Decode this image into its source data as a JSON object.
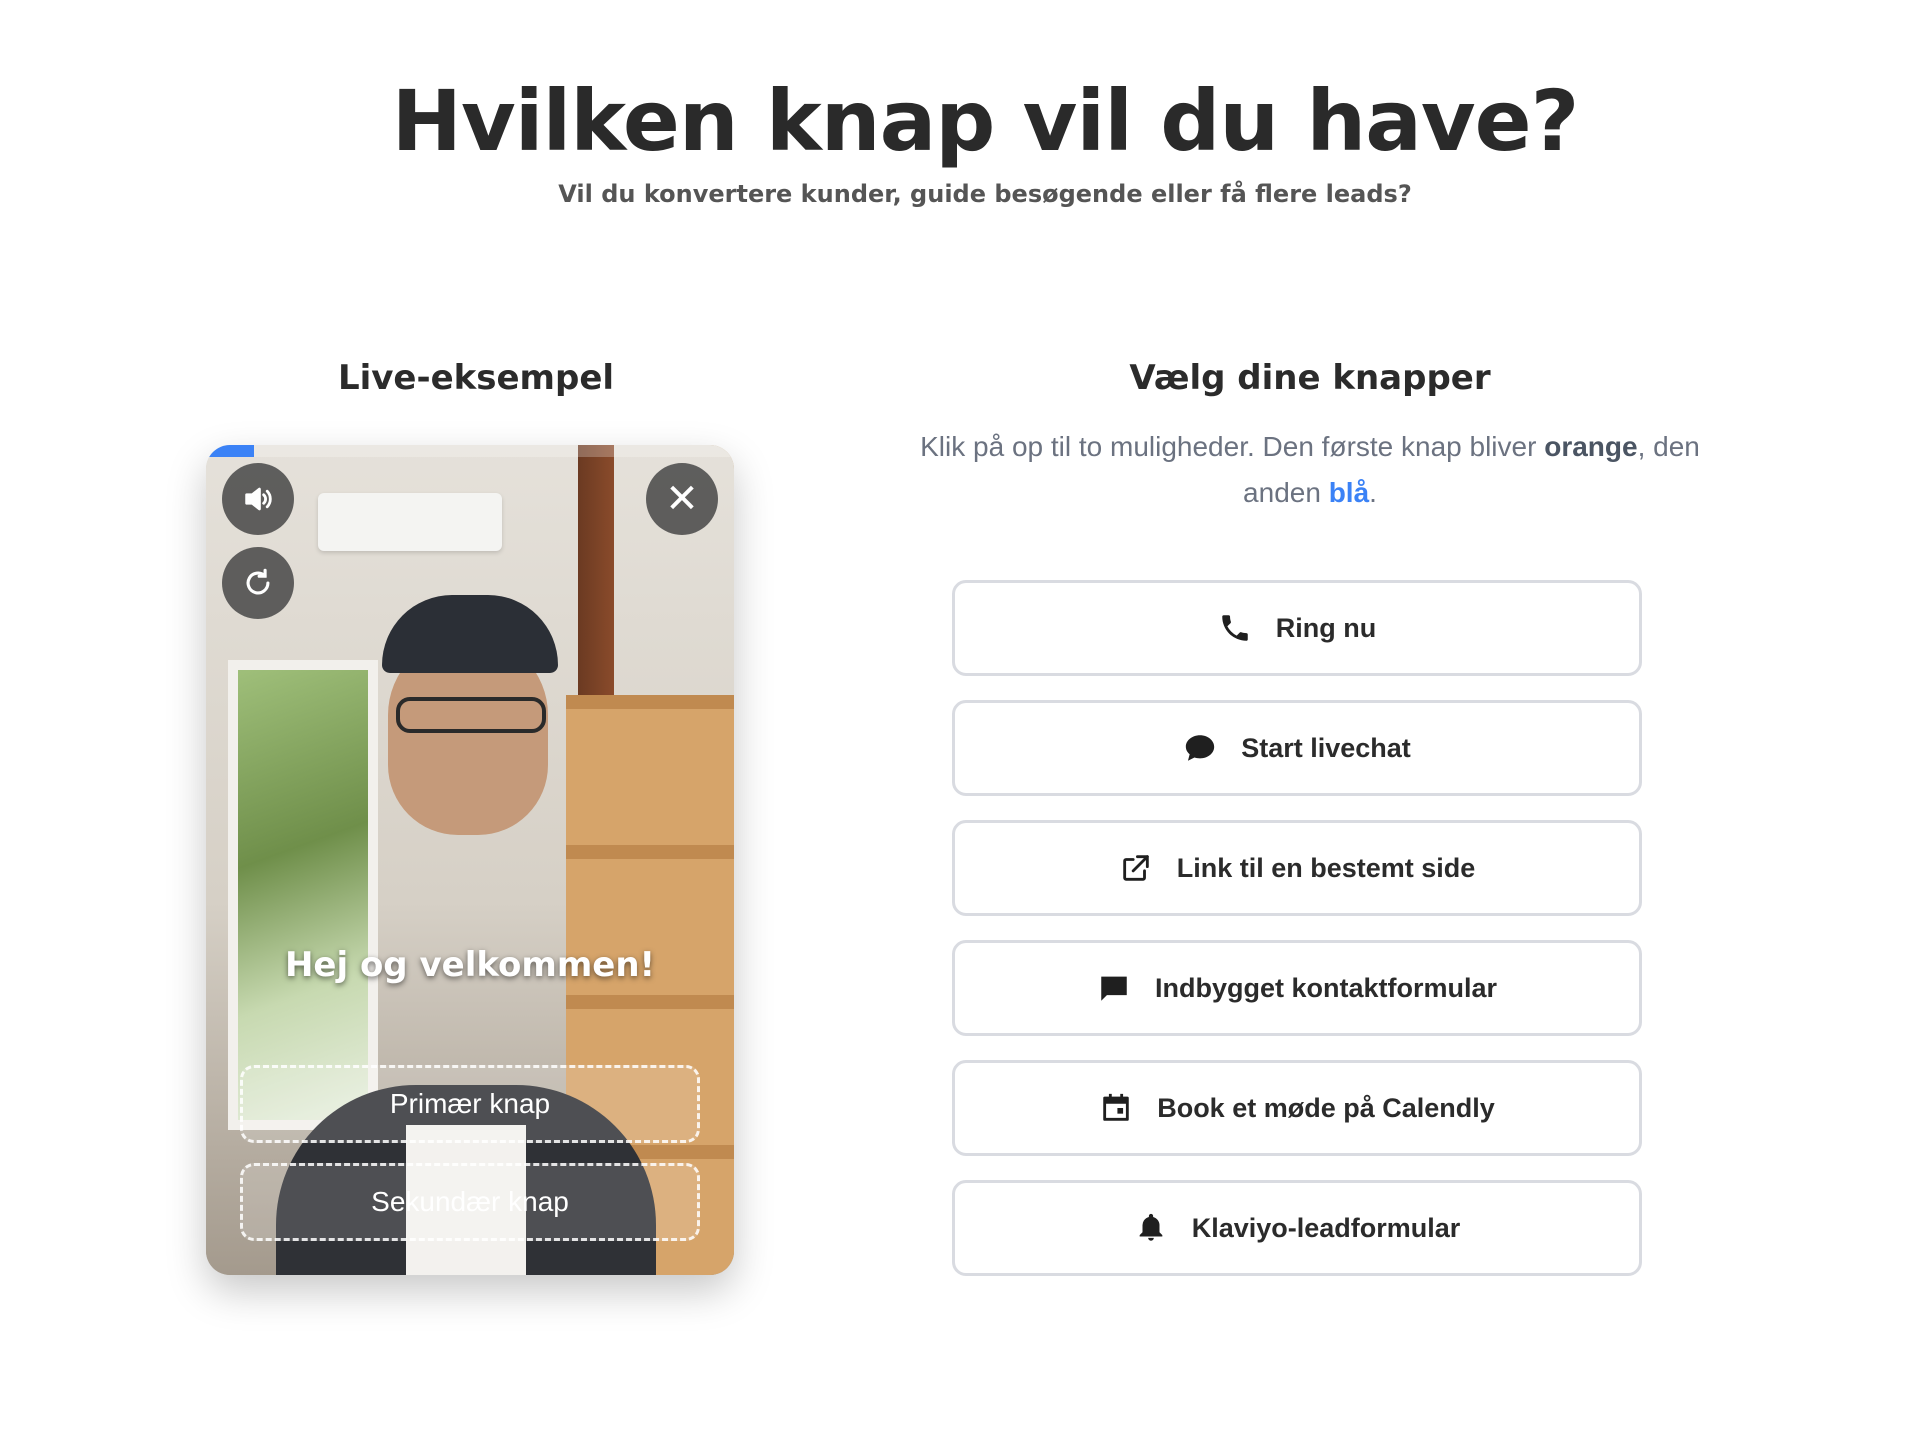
{
  "header": {
    "title": "Hvilken knap vil du have?",
    "subtitle": "Vil du konvertere kunder, guide besøgende eller få flere leads?"
  },
  "preview": {
    "heading": "Live-eksempel",
    "progress": 0.09,
    "welcome_text": "Hej og velkommen!",
    "primary_placeholder": "Primær knap",
    "secondary_placeholder": "Sekundær knap",
    "close_glyph": "✕",
    "icons": [
      "speaker-icon",
      "replay-icon",
      "close-icon"
    ]
  },
  "chooser": {
    "heading": "Vælg dine knapper",
    "instruction_part1": "Klik på op til to muligheder. Den første knap bliver ",
    "instruction_orange": "orange",
    "instruction_part2": ", den anden ",
    "instruction_blue": "blå",
    "instruction_part3": ".",
    "accent_blue": "#3b82f6",
    "options": [
      {
        "label": "Ring nu",
        "icon": "phone-icon"
      },
      {
        "label": "Start livechat",
        "icon": "chat-bubble-icon"
      },
      {
        "label": "Link til en bestemt side",
        "icon": "external-link-icon"
      },
      {
        "label": "Indbygget kontaktformular",
        "icon": "message-icon"
      },
      {
        "label": "Book et møde på Calendly",
        "icon": "calendar-icon"
      },
      {
        "label": "Klaviyo-leadformular",
        "icon": "bell-icon"
      }
    ]
  }
}
